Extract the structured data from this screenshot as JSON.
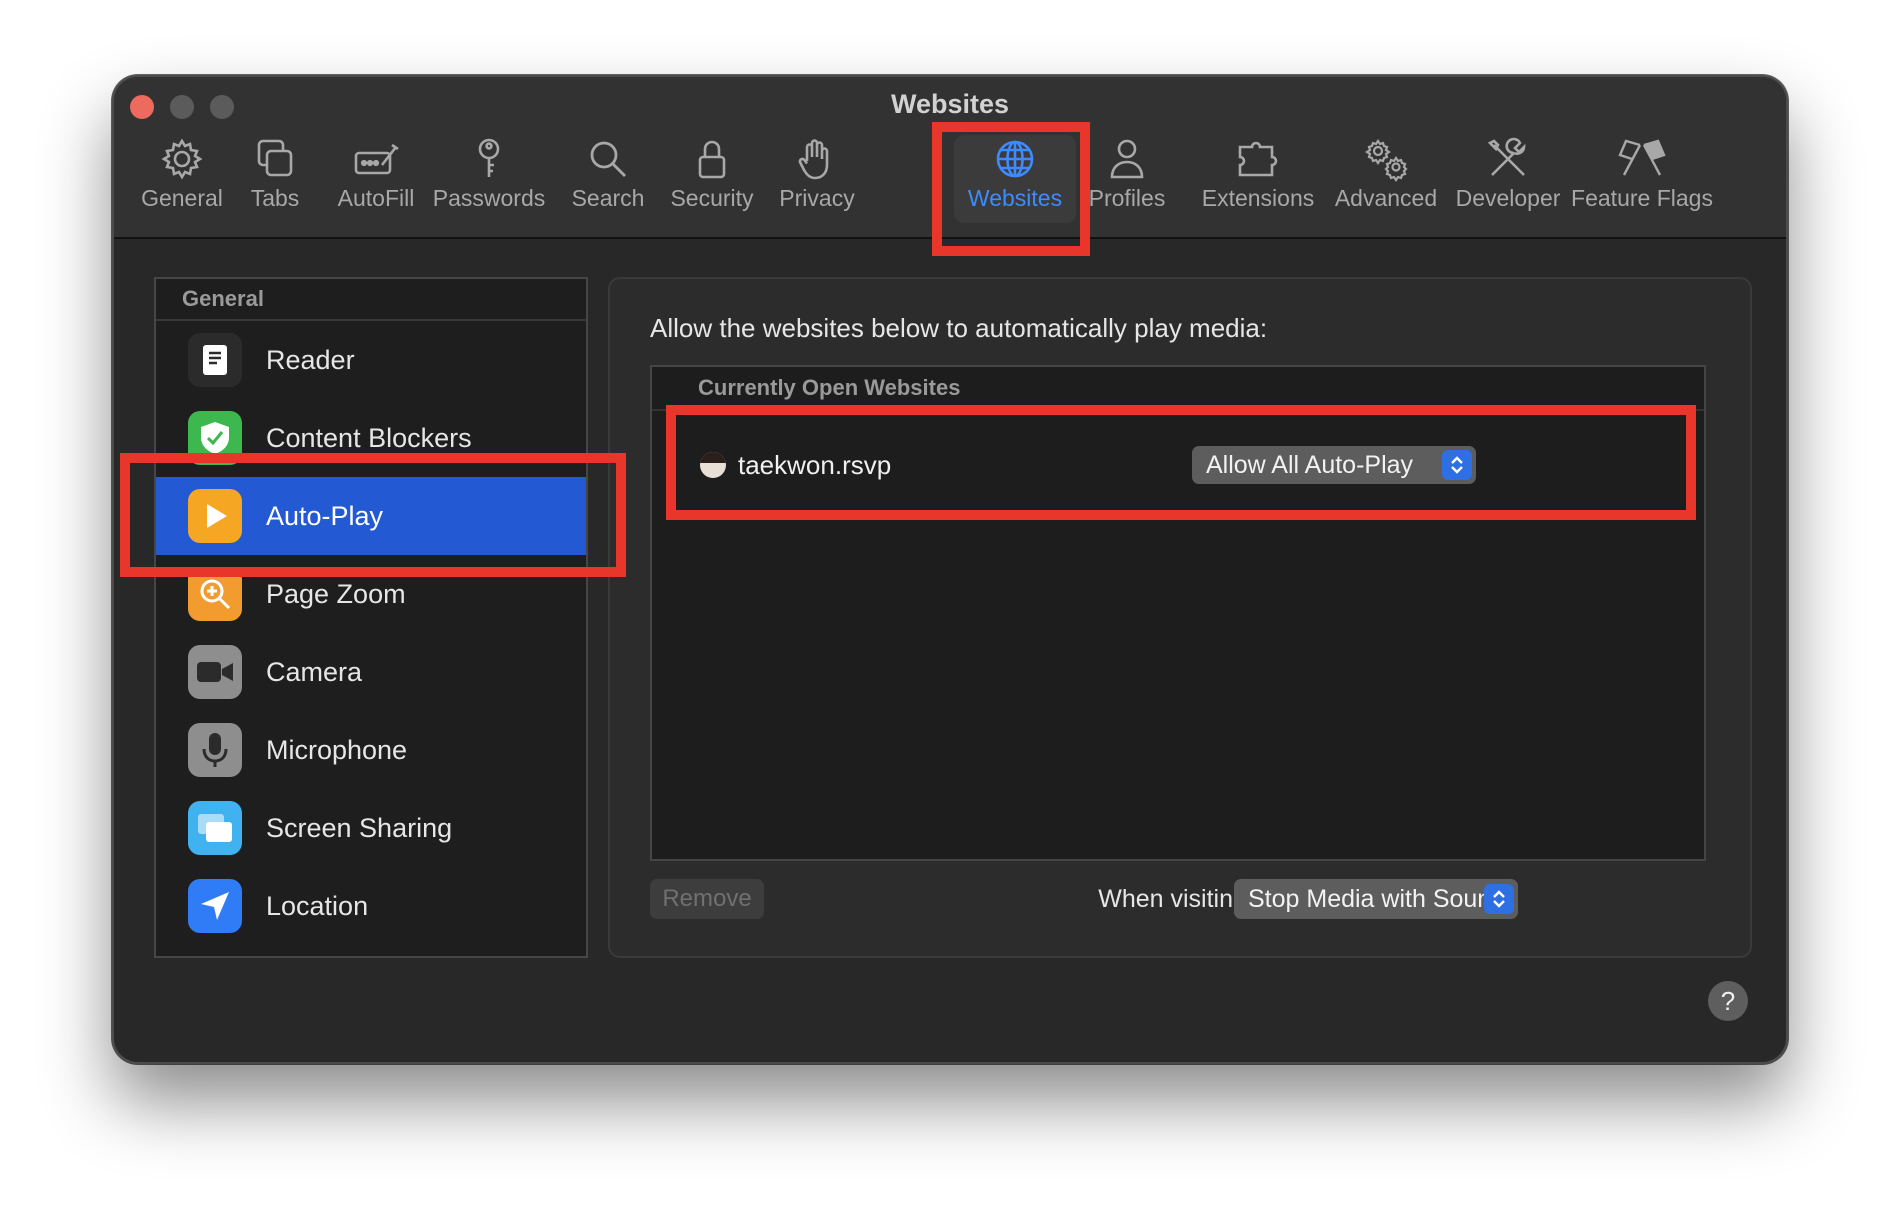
{
  "window": {
    "title": "Websites"
  },
  "toolbar": {
    "items": [
      {
        "label": "General",
        "icon": "gear-icon"
      },
      {
        "label": "Tabs",
        "icon": "tabs-icon"
      },
      {
        "label": "AutoFill",
        "icon": "autofill-icon"
      },
      {
        "label": "Passwords",
        "icon": "key-icon"
      },
      {
        "label": "Search",
        "icon": "search-icon"
      },
      {
        "label": "Security",
        "icon": "lock-icon"
      },
      {
        "label": "Privacy",
        "icon": "hand-icon"
      },
      {
        "label": "Websites",
        "icon": "globe-icon",
        "selected": true
      },
      {
        "label": "Profiles",
        "icon": "person-icon"
      },
      {
        "label": "Extensions",
        "icon": "puzzle-icon"
      },
      {
        "label": "Advanced",
        "icon": "gears-icon"
      },
      {
        "label": "Developer",
        "icon": "tools-icon"
      },
      {
        "label": "Feature Flags",
        "icon": "flags-icon"
      }
    ]
  },
  "sidebar": {
    "header": "General",
    "items": [
      {
        "label": "Reader",
        "icon": "reader-icon"
      },
      {
        "label": "Content Blockers",
        "icon": "shield-check-icon"
      },
      {
        "label": "Auto-Play",
        "icon": "play-icon",
        "selected": true
      },
      {
        "label": "Page Zoom",
        "icon": "zoom-icon"
      },
      {
        "label": "Camera",
        "icon": "camera-icon"
      },
      {
        "label": "Microphone",
        "icon": "microphone-icon"
      },
      {
        "label": "Screen Sharing",
        "icon": "screen-sharing-icon"
      },
      {
        "label": "Location",
        "icon": "location-arrow-icon"
      }
    ]
  },
  "main": {
    "description": "Allow the websites below to automatically play media:",
    "table_header": "Currently Open Websites",
    "sites": [
      {
        "name": "taekwon.rsvp",
        "setting": "Allow All Auto-Play"
      }
    ],
    "remove_label": "Remove",
    "other_label": "When visiting other websites:",
    "other_value": "Stop Media with Sound"
  },
  "help_label": "?",
  "colors": {
    "accent": "#3d8bff",
    "selection": "#2459d4",
    "highlight": "#e8362b"
  }
}
